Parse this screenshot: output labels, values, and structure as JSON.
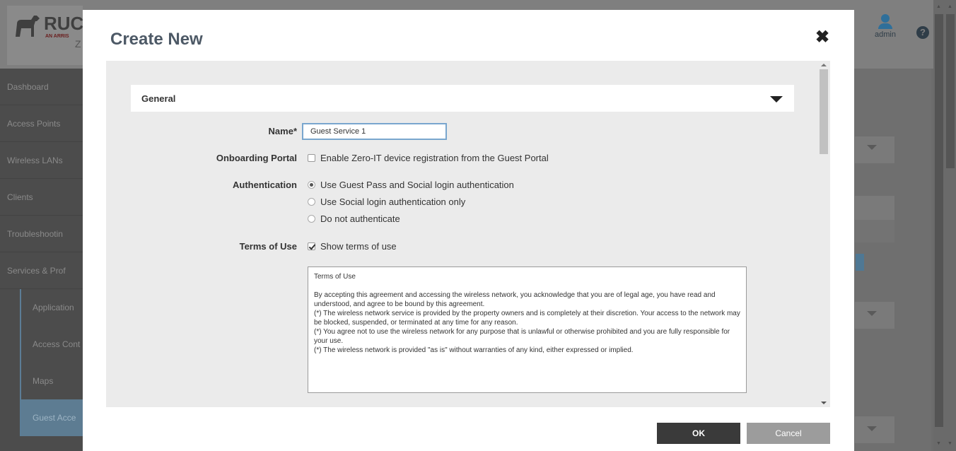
{
  "app": {
    "logo_text": "RUC",
    "logo_sub": "AN ARRIS",
    "logo_z": "Z",
    "user": "admin",
    "help": "?"
  },
  "sidebar": {
    "items": [
      {
        "label": "Dashboard"
      },
      {
        "label": "Access Points"
      },
      {
        "label": "Wireless LANs"
      },
      {
        "label": "Clients"
      },
      {
        "label": "Troubleshootin"
      },
      {
        "label": "Services & Prof"
      }
    ],
    "subitems": [
      {
        "label": "Application"
      },
      {
        "label": "Access Cont"
      },
      {
        "label": "Maps"
      },
      {
        "label": "Guest Acce"
      }
    ]
  },
  "modal": {
    "title": "Create New",
    "section": "General",
    "fields": {
      "name_label": "Name*",
      "name_value": "Guest Service 1",
      "onboarding_label": "Onboarding Portal",
      "onboarding_option": "Enable Zero-IT device registration from the Guest Portal",
      "auth_label": "Authentication",
      "auth_options": [
        "Use Guest Pass and Social login authentication",
        "Use Social login authentication only",
        "Do not authenticate"
      ],
      "auth_selected": 0,
      "terms_label": "Terms of Use",
      "terms_option": "Show terms of use",
      "terms_checked": true,
      "terms_text": [
        "Terms of Use",
        "",
        "By accepting this agreement and accessing the wireless network, you acknowledge that you are of legal age, you have read and understood, and agree to be bound by this agreement.",
        "(*) The wireless network service is provided by the property owners and is completely at their discretion. Your access to the network may be blocked, suspended, or terminated at any time for any reason.",
        "(*) You agree not to use the wireless network for any purpose that is unlawful or otherwise prohibited and you are fully responsible for your use.",
        "(*) The wireless network is provided \"as is\" without warranties of any kind, either expressed or implied."
      ]
    },
    "buttons": {
      "ok": "OK",
      "cancel": "Cancel"
    }
  },
  "colors": {
    "primary_button": "#3a3a3a",
    "secondary_button": "#9c9c9c",
    "input_focus": "#79a6ce",
    "sidebar_active": "#5d7c92"
  }
}
